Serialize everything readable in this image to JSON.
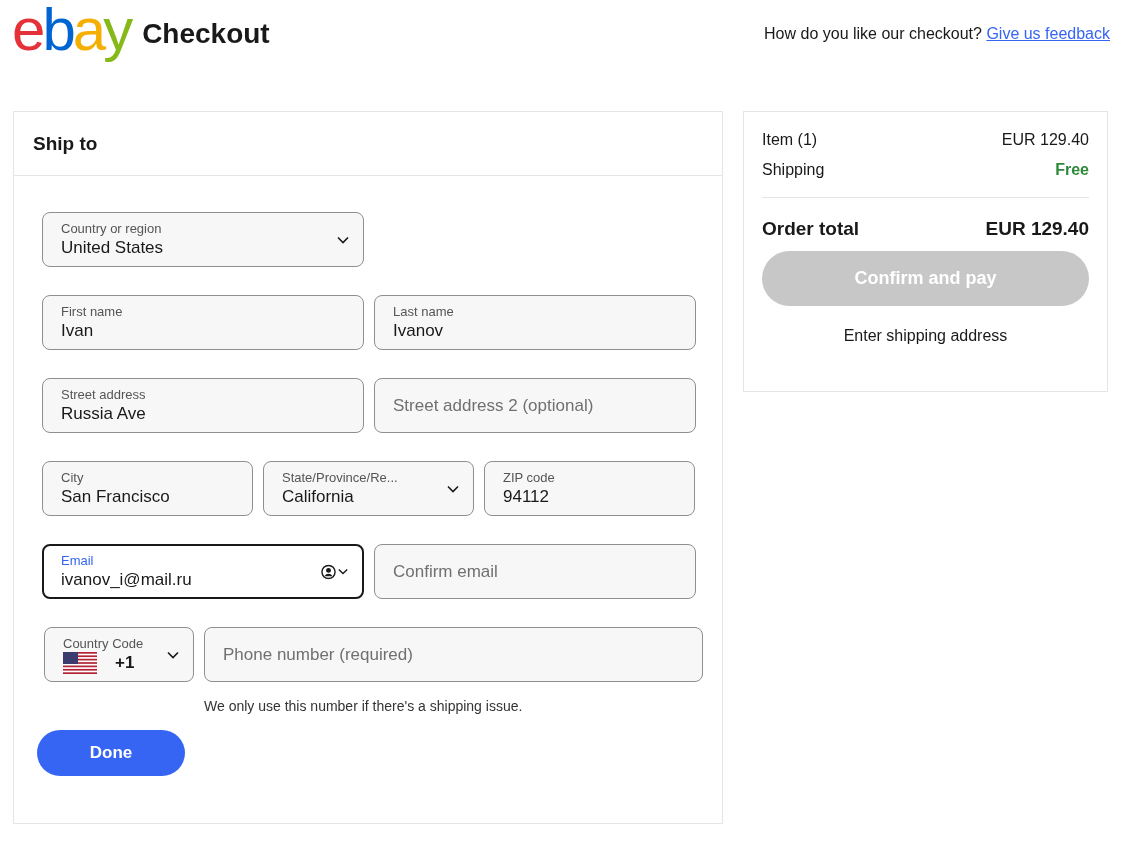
{
  "header": {
    "logo": "ebay",
    "title": "Checkout",
    "feedback_prompt": "How do you like our checkout?",
    "feedback_link": "Give us feedback"
  },
  "ship_to": {
    "title": "Ship to",
    "rows": [
      [
        {
          "kind": "select",
          "label": "Country or region",
          "value": "United States",
          "focused": false
        }
      ],
      [
        {
          "kind": "text",
          "label": "First name",
          "value": "Ivan",
          "focused": false
        },
        {
          "kind": "text",
          "label": "Last name",
          "value": "Ivanov",
          "focused": false
        }
      ],
      [
        {
          "kind": "text",
          "label": "Street address",
          "value": "Russia Ave",
          "focused": false
        },
        {
          "kind": "text",
          "placeholder": "Street address 2 (optional)",
          "focused": false
        }
      ],
      [
        {
          "kind": "text",
          "label": "City",
          "value": "San Francisco",
          "focused": false
        },
        {
          "kind": "select",
          "label": "State/Province/Re...",
          "value": "California",
          "focused": false
        },
        {
          "kind": "text",
          "label": "ZIP code",
          "value": "94112",
          "focused": false
        }
      ],
      [
        {
          "kind": "email",
          "label": "Email",
          "value": "ivanov_i@mail.ru",
          "focused": true
        },
        {
          "kind": "text",
          "placeholder": "Confirm email",
          "focused": false
        }
      ],
      [
        {
          "kind": "phone-code",
          "label": "Country Code",
          "value": "+1",
          "focused": false
        },
        {
          "kind": "text",
          "placeholder": "Phone number (required)",
          "focused": false
        }
      ]
    ],
    "phone_hint": "We only use this number if there's a shipping issue.",
    "done_button": "Done"
  },
  "summary": {
    "lines": [
      {
        "kind": "price",
        "label": "Item (1)",
        "value": "EUR 129.40"
      },
      {
        "kind": "free",
        "label": "Shipping",
        "value": "Free"
      }
    ],
    "total_label": "Order total",
    "total_value": "EUR 129.40",
    "confirm_button": {
      "label": "Confirm and pay",
      "disabled": true
    },
    "hint": "Enter shipping address"
  }
}
